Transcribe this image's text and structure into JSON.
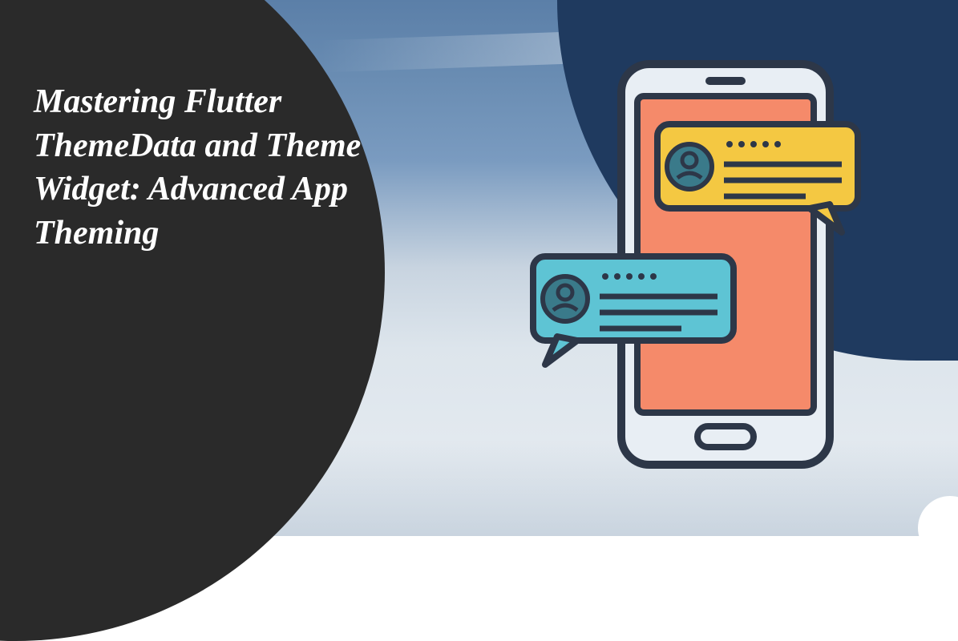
{
  "title": "Mastering Flutter ThemeData and Theme Widget: Advanced App Theming",
  "illustration": {
    "phone_color": "#e8eef4",
    "screen_color": "#f58a6a",
    "bubble1_color": "#f4c842",
    "bubble2_color": "#5ec4d4",
    "outline_color": "#2d3748"
  }
}
